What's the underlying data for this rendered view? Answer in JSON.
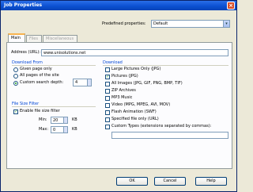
{
  "window": {
    "title": "Job Properties",
    "close_glyph": "×"
  },
  "header": {
    "predefined_label": "Predefined properties:",
    "predefined_value": "Default",
    "arrow": "▾"
  },
  "tabs": [
    {
      "label": "Main",
      "active": true
    },
    {
      "label": "Files",
      "active": false
    },
    {
      "label": "Miscellaneous",
      "active": false
    }
  ],
  "address": {
    "label": "Address (URL):",
    "value": "www.unisolutions.net"
  },
  "download_from": {
    "title": "Download From",
    "options": [
      {
        "label": "Given page only",
        "selected": false
      },
      {
        "label": "All pages of the site",
        "selected": false
      },
      {
        "label": "Custom search depth:",
        "selected": true
      }
    ],
    "depth_value": "4"
  },
  "file_size_filter": {
    "title": "File Size Filter",
    "enable_label": "Enable file size filter",
    "enabled": true,
    "min_label": "Min:",
    "min_value": "20",
    "min_unit": "KB",
    "max_label": "Max:",
    "max_value": "0",
    "max_unit": "KB"
  },
  "download": {
    "title": "Download",
    "items": [
      {
        "label": "Large Pictures Only (JPG)",
        "checked": false
      },
      {
        "label": "Pictures (JPG)",
        "checked": true
      },
      {
        "label": "All Images (JPG, GIF, PNG, BMP, TIF)",
        "checked": false
      },
      {
        "label": "ZIP Archives",
        "checked": false
      },
      {
        "label": "MP3 Music",
        "checked": false
      },
      {
        "label": "Video (MPG, MPEG, AVI, MOV)",
        "checked": false
      },
      {
        "label": "Flash Animation (SWF)",
        "checked": false
      },
      {
        "label": "Specified file only (URL)",
        "checked": false
      },
      {
        "label": "Custom Types (extensions separated by commas):",
        "checked": false
      }
    ],
    "custom_types_value": "",
    "check_glyph": "✓"
  },
  "buttons": {
    "ok": "OK",
    "cancel": "Cancel",
    "help": "Help"
  }
}
